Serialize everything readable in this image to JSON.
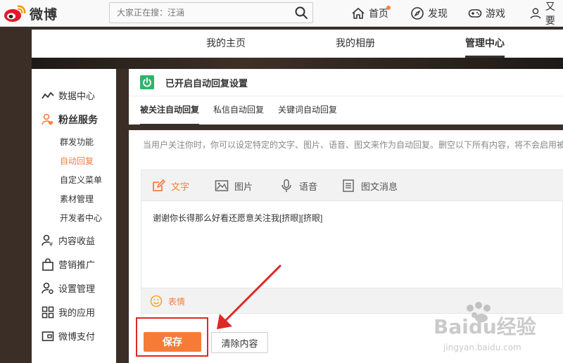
{
  "header": {
    "logo_text": "微博",
    "search_placeholder": "大家正在搜：汪涵",
    "nav": [
      {
        "label": "首页",
        "icon": "home-icon"
      },
      {
        "label": "发现",
        "icon": "compass-icon"
      },
      {
        "label": "游戏",
        "icon": "gamepad-icon"
      },
      {
        "label": "又要",
        "icon": "user-icon"
      }
    ]
  },
  "profile_tabs": [
    {
      "label": "我的主页"
    },
    {
      "label": "我的相册"
    },
    {
      "label": "管理中心",
      "active": true
    }
  ],
  "sidebar": {
    "data_center": "数据中心",
    "fans_service": "粉丝服务",
    "sub_items": [
      {
        "label": "群发功能"
      },
      {
        "label": "自动回复",
        "active": true
      },
      {
        "label": "自定义菜单"
      },
      {
        "label": "素材管理"
      },
      {
        "label": "开发者中心"
      }
    ],
    "content_income": "内容收益",
    "marketing": "营销推广",
    "settings": "设置管理",
    "my_apps": "我的应用",
    "weibo_pay": "微博支付"
  },
  "panel": {
    "status_text": "已开启自动回复设置",
    "tabs": [
      {
        "label": "被关注自动回复",
        "active": true
      },
      {
        "label": "私信自动回复"
      },
      {
        "label": "关键词自动回复"
      }
    ]
  },
  "content": {
    "hint": "当用户关注你时，你可以设定特定的文字、图片、语音、图文来作为自动回复。删空以下所有内容，将不会启用被",
    "editor_tabs": [
      {
        "label": "文字",
        "icon": "edit-icon",
        "active": true
      },
      {
        "label": "图片",
        "icon": "image-icon"
      },
      {
        "label": "语音",
        "icon": "microphone-icon"
      },
      {
        "label": "图文消息",
        "icon": "article-icon"
      }
    ],
    "reply_text": "谢谢你长得那么好看还愿意关注我[挤眼][挤眼]",
    "emoji_label": "表情",
    "save_label": "保存",
    "clear_label": "清除内容"
  },
  "watermark": {
    "brand": "Baidu经验",
    "url": "jingyan.baidu.com"
  },
  "colors": {
    "accent": "#fa7d3c",
    "status_green": "#2fb46e",
    "highlight_red": "#e02727"
  }
}
